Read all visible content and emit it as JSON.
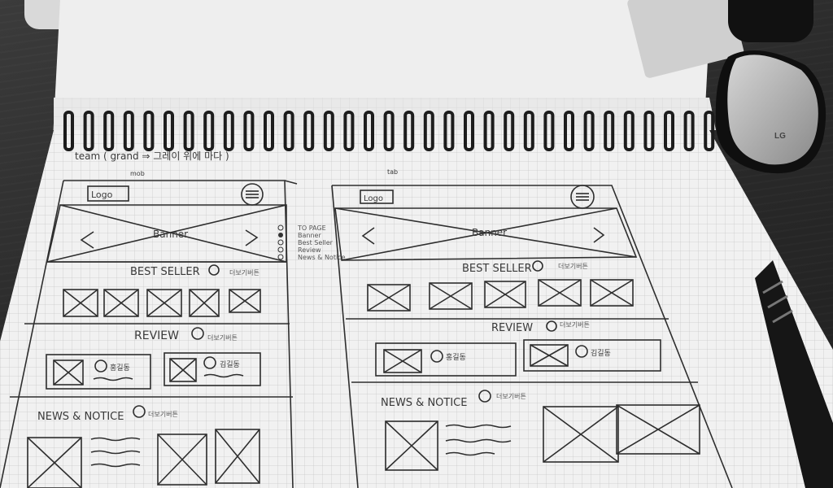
{
  "header": {
    "team_note": "team ( grand ⇒ 그레이 위에 마다 )",
    "left_label": "mob",
    "right_label": "tab"
  },
  "mob": {
    "logo": "Logo",
    "banner": "Banner",
    "best_seller": "BEST SELLER",
    "review": "REVIEW",
    "news": "NEWS & NOTICE",
    "review_names": [
      "홍길동",
      "김길동"
    ]
  },
  "tab": {
    "logo": "Logo",
    "banner": "Banner",
    "best_seller": "BEST SELLER",
    "review": "REVIEW",
    "news": "NEWS & NOTICE",
    "review_names": [
      "홍길동",
      "김길동"
    ]
  },
  "annotations": {
    "side_menu": [
      "TO PAGE",
      "Banner",
      "Best Seller",
      "Review",
      "News & Notice"
    ],
    "more": "더보기버튼"
  },
  "objects": {
    "mouse_brand": "LG"
  },
  "icons": [
    "hamburger-icon",
    "plus-circle-icon",
    "image-placeholder-icon",
    "arrow-left-icon",
    "arrow-right-icon",
    "avatar-icon",
    "pen-icon",
    "mouse-icon"
  ]
}
